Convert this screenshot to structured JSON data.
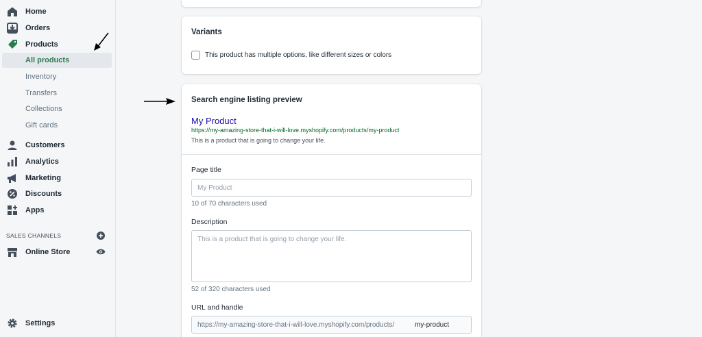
{
  "sidebar": {
    "items": [
      {
        "label": "Home",
        "icon": "home-icon"
      },
      {
        "label": "Orders",
        "icon": "orders-icon"
      },
      {
        "label": "Products",
        "icon": "tag-icon"
      },
      {
        "label": "Customers",
        "icon": "person-icon"
      },
      {
        "label": "Analytics",
        "icon": "bar-chart-icon"
      },
      {
        "label": "Marketing",
        "icon": "megaphone-icon"
      },
      {
        "label": "Discounts",
        "icon": "discount-icon"
      },
      {
        "label": "Apps",
        "icon": "apps-icon"
      }
    ],
    "product_subitems": [
      "All products",
      "Inventory",
      "Transfers",
      "Collections",
      "Gift cards"
    ],
    "sales_channels_title": "SALES CHANNELS",
    "online_store": "Online Store",
    "settings": "Settings"
  },
  "variants": {
    "title": "Variants",
    "checkbox_label": "This product has multiple options, like different sizes or colors"
  },
  "seo": {
    "title": "Search engine listing preview",
    "preview_title": "My Product",
    "preview_url": "https://my-amazing-store-that-i-will-love.myshopify.com/products/my-product",
    "preview_description": "This is a product that is going to change your life.",
    "page_title_label": "Page title",
    "page_title_placeholder": "My Product",
    "page_title_help": "10 of 70 characters used",
    "description_label": "Description",
    "description_placeholder": "This is a product that is going to change your life.",
    "description_help": "52 of 320 characters used",
    "url_label": "URL and handle",
    "url_prefix": "https://my-amazing-store-that-i-will-love.myshopify.com/products/",
    "url_handle": "my-product"
  },
  "colors": {
    "accent_green": "#2c7a50",
    "link_blue": "#1a0dab",
    "url_green": "#006621"
  }
}
